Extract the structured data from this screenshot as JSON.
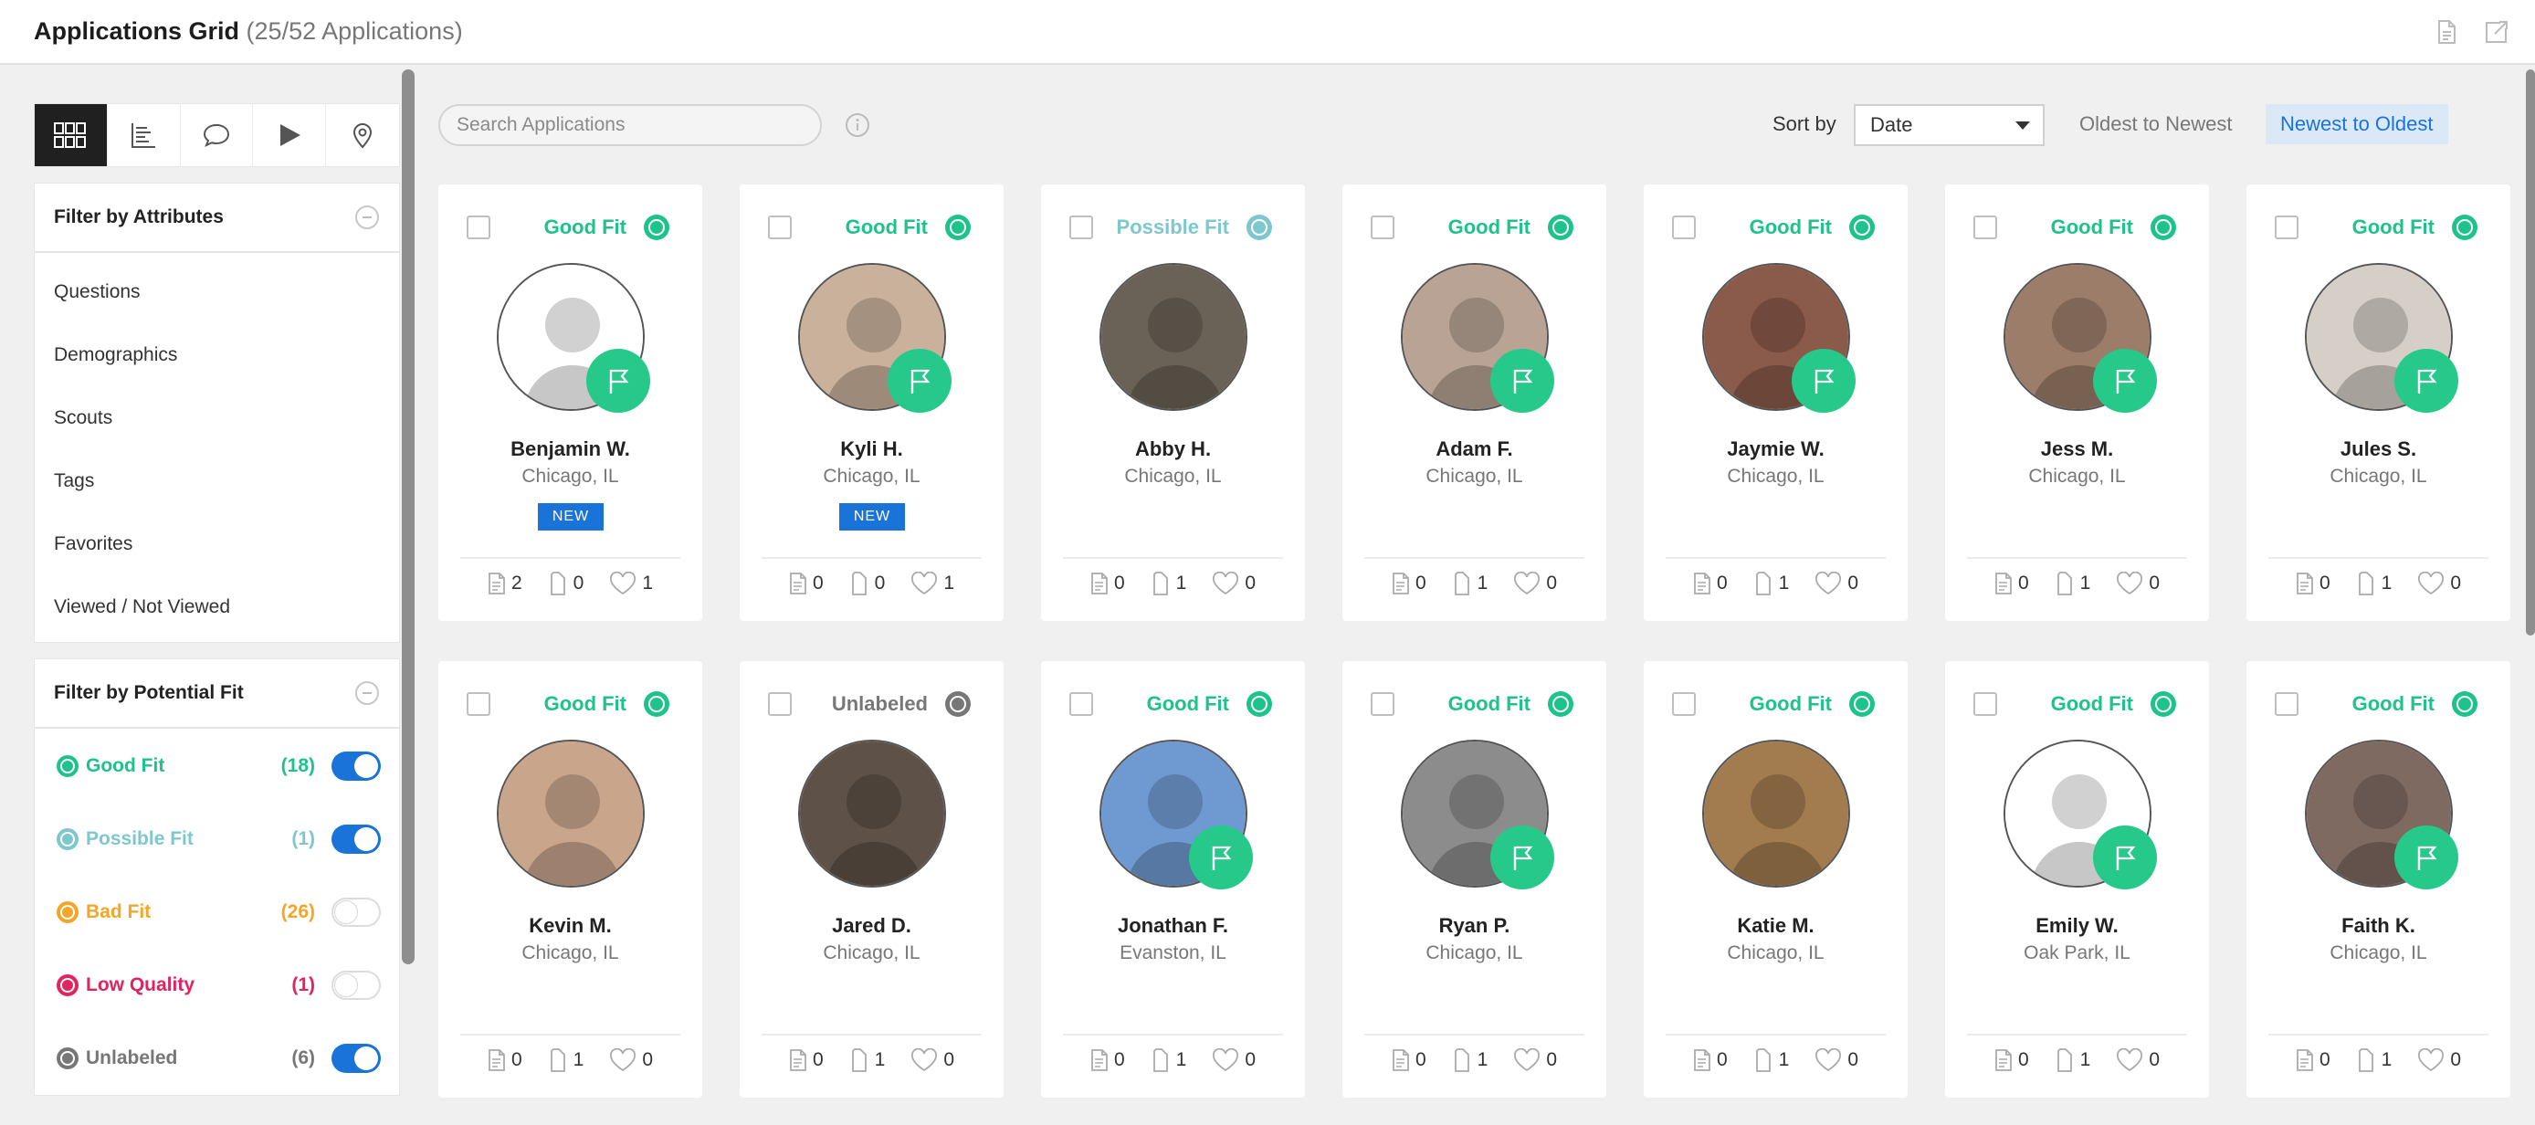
{
  "header": {
    "title": "Applications Grid",
    "count": "(25/52 Applications)",
    "icons": [
      "document-icon",
      "export-icon"
    ]
  },
  "sidebar": {
    "views": [
      "grid-view-icon",
      "list-view-icon",
      "chat-view-icon",
      "video-view-icon",
      "map-view-icon"
    ],
    "attributes": {
      "title": "Filter by Attributes",
      "items": [
        "Questions",
        "Demographics",
        "Scouts",
        "Tags",
        "Favorites",
        "Viewed / Not Viewed"
      ]
    },
    "potential_fit": {
      "title": "Filter by Potential Fit",
      "items": [
        {
          "label": "Good Fit",
          "count": "(18)",
          "color": "#1ec38b",
          "on": true
        },
        {
          "label": "Possible Fit",
          "count": "(1)",
          "color": "#7fc7cf",
          "on": true
        },
        {
          "label": "Bad Fit",
          "count": "(26)",
          "color": "#f4a62a",
          "on": false
        },
        {
          "label": "Low Quality",
          "count": "(1)",
          "color": "#e0245e",
          "on": false
        },
        {
          "label": "Unlabeled",
          "count": "(6)",
          "color": "#777777",
          "on": true
        }
      ]
    }
  },
  "toolbar": {
    "search_placeholder": "Search Applications",
    "sort_label": "Sort by",
    "sort_value": "Date",
    "oldest": "Oldest to Newest",
    "newest": "Newest to Oldest"
  },
  "colors": {
    "good": "#1ec38b",
    "possible": "#7fc7cf",
    "unlabeled": "#777777",
    "flag": "#27c98a",
    "accent": "#1a73d9"
  },
  "cards": [
    {
      "fit": "Good Fit",
      "fitcolor": "#1ec38b",
      "name": "Benjamin W.",
      "loc": "Chicago, IL",
      "new": "NEW",
      "docs": "2",
      "tags": "0",
      "likes": "1",
      "flag": true,
      "bg": "#ffffff"
    },
    {
      "fit": "Good Fit",
      "fitcolor": "#1ec38b",
      "name": "Kyli H.",
      "loc": "Chicago, IL",
      "new": "NEW",
      "docs": "0",
      "tags": "0",
      "likes": "1",
      "flag": true,
      "bg": "#c9b19c"
    },
    {
      "fit": "Possible Fit",
      "fitcolor": "#7fc7cf",
      "name": "Abby H.",
      "loc": "Chicago, IL",
      "docs": "0",
      "tags": "1",
      "likes": "0",
      "flag": false,
      "bg": "#6b6257"
    },
    {
      "fit": "Good Fit",
      "fitcolor": "#1ec38b",
      "name": "Adam F.",
      "loc": "Chicago, IL",
      "docs": "0",
      "tags": "1",
      "likes": "0",
      "flag": true,
      "bg": "#b8a394"
    },
    {
      "fit": "Good Fit",
      "fitcolor": "#1ec38b",
      "name": "Jaymie W.",
      "loc": "Chicago, IL",
      "docs": "0",
      "tags": "1",
      "likes": "0",
      "flag": true,
      "bg": "#8a5a4a"
    },
    {
      "fit": "Good Fit",
      "fitcolor": "#1ec38b",
      "name": "Jess M.",
      "loc": "Chicago, IL",
      "docs": "0",
      "tags": "1",
      "likes": "0",
      "flag": true,
      "bg": "#9c7d6a"
    },
    {
      "fit": "Good Fit",
      "fitcolor": "#1ec38b",
      "name": "Jules S.",
      "loc": "Chicago, IL",
      "docs": "0",
      "tags": "1",
      "likes": "0",
      "flag": true,
      "bg": "#d6cfc8"
    },
    {
      "fit": "Good Fit",
      "fitcolor": "#1ec38b",
      "name": "Kevin M.",
      "loc": "Chicago, IL",
      "docs": "0",
      "tags": "1",
      "likes": "0",
      "flag": false,
      "bg": "#c9a58c"
    },
    {
      "fit": "Unlabeled",
      "fitcolor": "#777777",
      "name": "Jared D.",
      "loc": "Chicago, IL",
      "docs": "0",
      "tags": "1",
      "likes": "0",
      "flag": false,
      "bg": "#5e5147"
    },
    {
      "fit": "Good Fit",
      "fitcolor": "#1ec38b",
      "name": "Jonathan F.",
      "loc": "Evanston, IL",
      "docs": "0",
      "tags": "1",
      "likes": "0",
      "flag": true,
      "bg": "#6f9ad1"
    },
    {
      "fit": "Good Fit",
      "fitcolor": "#1ec38b",
      "name": "Ryan P.",
      "loc": "Chicago, IL",
      "docs": "0",
      "tags": "1",
      "likes": "0",
      "flag": true,
      "bg": "#8c8c8c"
    },
    {
      "fit": "Good Fit",
      "fitcolor": "#1ec38b",
      "name": "Katie M.",
      "loc": "Chicago, IL",
      "docs": "0",
      "tags": "1",
      "likes": "0",
      "flag": false,
      "bg": "#a27b4f"
    },
    {
      "fit": "Good Fit",
      "fitcolor": "#1ec38b",
      "name": "Emily W.",
      "loc": "Oak Park, IL",
      "docs": "0",
      "tags": "1",
      "likes": "0",
      "flag": true,
      "bg": "#ffffff"
    },
    {
      "fit": "Good Fit",
      "fitcolor": "#1ec38b",
      "name": "Faith K.",
      "loc": "Chicago, IL",
      "docs": "0",
      "tags": "1",
      "likes": "0",
      "flag": true,
      "bg": "#7f6a62"
    }
  ]
}
